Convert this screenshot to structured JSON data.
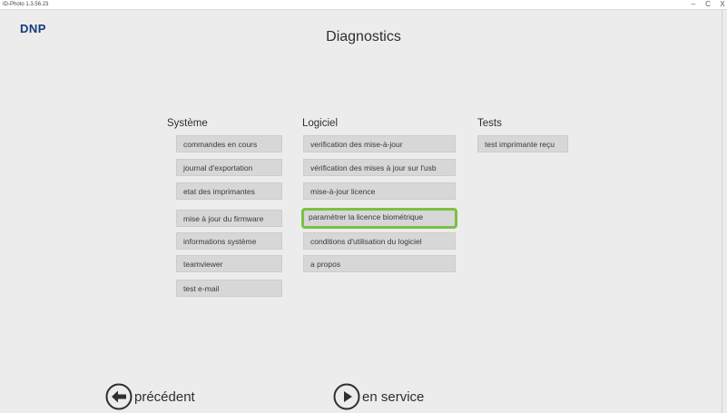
{
  "window": {
    "title": "ID-Photo 1.3.56.23",
    "minimize": "–",
    "restore": "C",
    "close": "X"
  },
  "header": {
    "logo": "DNP",
    "title": "Diagnostics"
  },
  "columns": {
    "systeme": {
      "heading": "Système",
      "items": [
        {
          "label": "commandes en cours"
        },
        {
          "label": "journal d'exportation"
        },
        {
          "label": "etat des imprimantes"
        },
        {
          "label": "mise à jour du firmware"
        },
        {
          "label": "informations système"
        },
        {
          "label": "teamviewer"
        },
        {
          "label": "test e-mail"
        }
      ]
    },
    "logiciel": {
      "heading": "Logiciel",
      "items": [
        {
          "label": "verification des mise-à-jour"
        },
        {
          "label": "vérification des mises à jour sur l'usb"
        },
        {
          "label": "mise-à-jour licence"
        },
        {
          "label": "paramétrer la licence biométrique"
        },
        {
          "label": "conditions d'utilisation du logiciel"
        },
        {
          "label": "a propos"
        }
      ]
    },
    "tests": {
      "heading": "Tests",
      "items": [
        {
          "label": "test imprimante reçu"
        }
      ]
    }
  },
  "footer": {
    "back_label": "précédent",
    "service_label": "en service",
    "back_icon": "arrow-left-circle-icon",
    "service_icon": "play-circle-icon"
  },
  "colors": {
    "highlight": "#7ac142",
    "button_bg": "#d7d7d7",
    "logo": "#123a7c"
  }
}
